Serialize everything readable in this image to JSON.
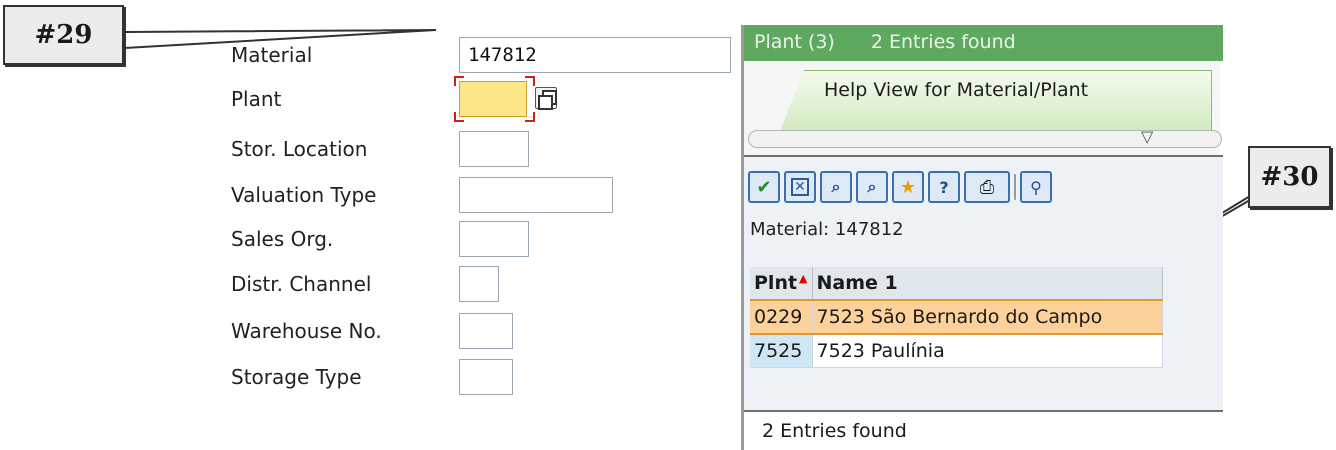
{
  "callouts": {
    "first": "#29",
    "second": "#30"
  },
  "form": {
    "fields": [
      {
        "label": "Material",
        "value": "147812"
      },
      {
        "label": "Plant",
        "value": ""
      },
      {
        "label": "Stor. Location",
        "value": ""
      },
      {
        "label": "Valuation Type",
        "value": ""
      },
      {
        "label": "Sales Org.",
        "value": ""
      },
      {
        "label": "Distr. Channel",
        "value": ""
      },
      {
        "label": "Warehouse No.",
        "value": ""
      },
      {
        "label": "Storage Type",
        "value": ""
      }
    ],
    "plant_help_icon": "copy-icon"
  },
  "help_dialog": {
    "title": "Plant (3)",
    "title_status": "2 Entries found",
    "tab_label": "Help View for Material/Plant",
    "toolbar_icons": [
      "check-icon",
      "cancel-icon",
      "find-icon",
      "find-next-icon",
      "favorites-add-icon",
      "info-icon",
      "print-icon",
      "settings-icon"
    ],
    "material_line": "Material: 147812",
    "table": {
      "columns": [
        "Plnt",
        "Name 1"
      ],
      "rows": [
        [
          "0229",
          "7523 São Bernardo do Campo"
        ],
        [
          "7525",
          "7523 Paulínia"
        ]
      ]
    },
    "status": "2 Entries found"
  },
  "colors": {
    "focus_field": "#fde68a",
    "title_bar": "#5fa85f",
    "selected_row": "#fdd19a"
  }
}
